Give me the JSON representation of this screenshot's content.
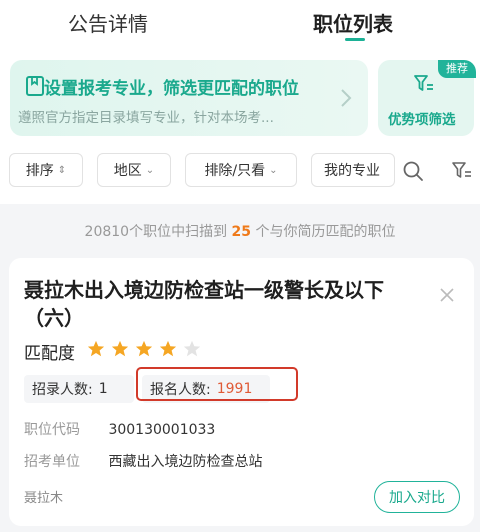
{
  "tabs": [
    {
      "label": "公告详情"
    },
    {
      "label": "职位列表"
    }
  ],
  "banner": {
    "title": "设置报考专业，筛选更匹配的职位",
    "subtitle": "遵照官方指定目录填写专业，针对本场考..."
  },
  "advantage": {
    "badge": "推荐",
    "label": "优势项筛选"
  },
  "filters": {
    "sort": "排序",
    "region": "地区",
    "exclude": "排除/只看",
    "major": "我的专业"
  },
  "scan": {
    "prefix": "20810个职位中扫描到",
    "count": "25",
    "suffix": "个与你简历匹配的职位"
  },
  "job": {
    "title": "聂拉木出入境边防检查站一级警长及以下（六）",
    "match_label": "匹配度",
    "match_stars": 4,
    "match_max": 5,
    "recruit_label": "招录人数:",
    "recruit_count": "1",
    "applied_label": "报名人数:",
    "applied_count": "1991",
    "code_label": "职位代码",
    "code_value": "300130001033",
    "unit_label": "招考单位",
    "unit_value": "西藏出入境边防检查总站",
    "location": "聂拉木",
    "compare_button": "加入对比"
  },
  "colors": {
    "accent": "#1aa98d",
    "star": "#f5a623",
    "highlight": "#ef7a1a",
    "annotation": "#d23a2a"
  }
}
